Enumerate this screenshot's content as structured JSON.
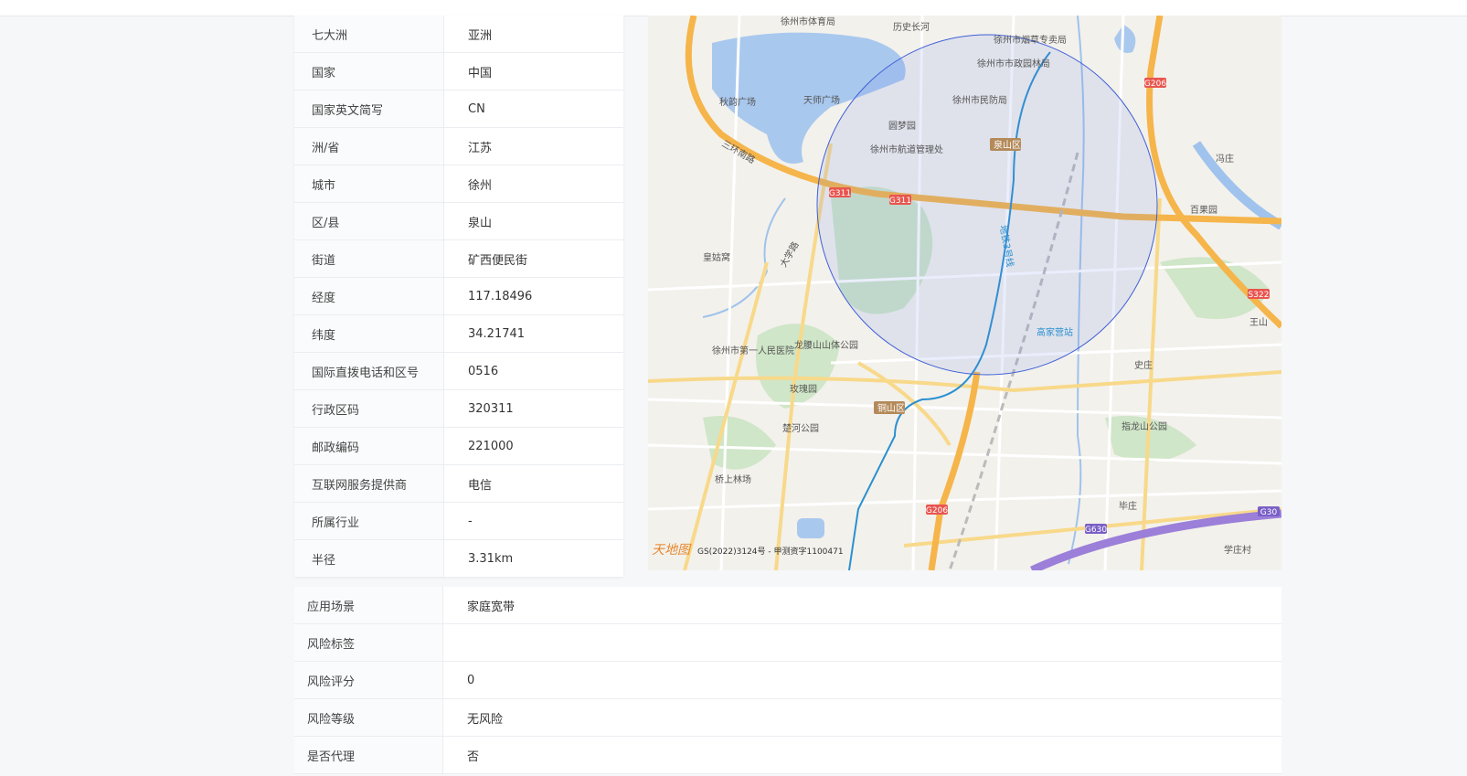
{
  "info_rows": [
    {
      "label": "七大洲",
      "value": "亚洲"
    },
    {
      "label": "国家",
      "value": "中国"
    },
    {
      "label": "国家英文简写",
      "value": "CN"
    },
    {
      "label": "洲/省",
      "value": "江苏"
    },
    {
      "label": "城市",
      "value": "徐州"
    },
    {
      "label": "区/县",
      "value": "泉山"
    },
    {
      "label": "街道",
      "value": "矿西便民街"
    },
    {
      "label": "经度",
      "value": "117.18496"
    },
    {
      "label": "纬度",
      "value": "34.21741"
    },
    {
      "label": "国际直拨电话和区号",
      "value": "0516"
    },
    {
      "label": "行政区码",
      "value": "320311"
    },
    {
      "label": "邮政编码",
      "value": "221000"
    },
    {
      "label": "互联网服务提供商",
      "value": "电信"
    },
    {
      "label": "所属行业",
      "value": "-"
    },
    {
      "label": "半径",
      "value": "3.31km"
    }
  ],
  "bottom_rows": [
    {
      "label": "应用场景",
      "value": "家庭宽带"
    },
    {
      "label": "风险标签",
      "value": ""
    },
    {
      "label": "风险评分",
      "value": "0"
    },
    {
      "label": "风险等级",
      "value": "无风险"
    },
    {
      "label": "是否代理",
      "value": "否"
    }
  ],
  "map": {
    "places": [
      "徐州市体育局",
      "历史长河",
      "徐州市烟草专卖局",
      "徐州市市政园林局",
      "秋韵广场",
      "天师广场",
      "徐州市民防局",
      "圆梦园",
      "徐州市航道管理处",
      "泉山区",
      "冯庄",
      "百果园",
      "皇姑窝",
      "大学路",
      "三环南路",
      "地铁3号线",
      "高家营站",
      "王山",
      "徐州市第一人民医院",
      "龙腰山山体公园",
      "史庄",
      "玫瑰园",
      "铜山区",
      "指龙山公园",
      "楚河公园",
      "桥上林场",
      "毕庄",
      "学庄村"
    ],
    "road_codes": [
      "G206",
      "G311",
      "G311",
      "S322",
      "G206",
      "G630",
      "G30"
    ],
    "copyright": "GS(2022)3124号 - 甲测资字1100471",
    "logo_text": "天地图",
    "colors": {
      "water": "#a9c8ee",
      "green": "#c9e3c4",
      "road_major": "#f5b54a",
      "road_minor": "#f8d98a",
      "circle_fill": "#6d8ae8",
      "circle_stroke": "#3f5fd6",
      "metro": "#2a90d0",
      "highway": "#9b7fd9"
    }
  }
}
